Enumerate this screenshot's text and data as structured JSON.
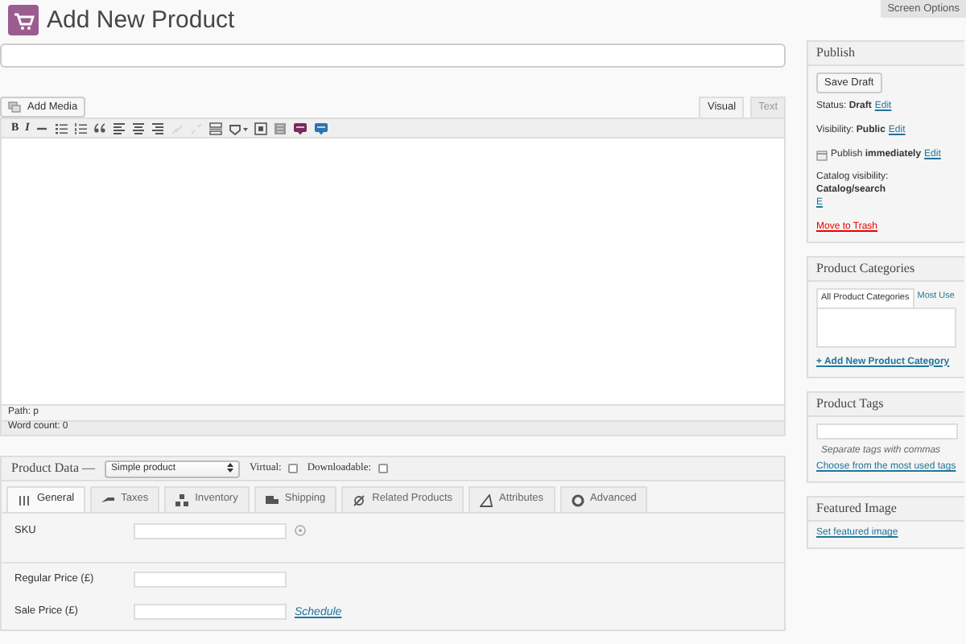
{
  "page_title": "Add New Product",
  "screen_options": "Screen Options",
  "editor": {
    "add_media": "Add Media",
    "tabs": [
      {
        "label": "Visual",
        "selected": true
      },
      {
        "label": "Text",
        "selected": false
      }
    ],
    "toolbar": [
      {
        "kind": "letter",
        "label": "B",
        "disabled": false
      },
      {
        "kind": "letter",
        "label": "I",
        "disabled": false
      },
      {
        "kind": "strike",
        "disabled": false
      },
      {
        "kind": "bullets",
        "disabled": false
      },
      {
        "kind": "numbers",
        "disabled": false
      },
      {
        "kind": "quote",
        "disabled": false
      },
      {
        "kind": "align-left",
        "disabled": false
      },
      {
        "kind": "align-center",
        "disabled": false
      },
      {
        "kind": "align-right",
        "disabled": false
      },
      {
        "kind": "link",
        "disabled": true
      },
      {
        "kind": "unlink",
        "disabled": true
      },
      {
        "kind": "more",
        "disabled": false
      },
      {
        "kind": "spellcheck",
        "disabled": false
      },
      {
        "kind": "fullscreen",
        "disabled": false
      },
      {
        "kind": "kitchen-sink",
        "disabled": false
      },
      {
        "kind": "plugin",
        "color": "#7b2a5c",
        "disabled": false
      },
      {
        "kind": "plugin",
        "color": "#2c73b0",
        "disabled": false
      }
    ],
    "path": "Path: p",
    "word_count": "Word count: 0"
  },
  "product_data": {
    "title": "Product Data —",
    "type": "Simple product",
    "options": [
      {
        "label": "Virtual:",
        "checked": false
      },
      {
        "label": "Downloadable:",
        "checked": false
      }
    ],
    "tabs": [
      {
        "label": "General",
        "kind": "general",
        "selected": true
      },
      {
        "label": "Taxes",
        "kind": "taxes",
        "selected": false
      },
      {
        "label": "Inventory",
        "kind": "inventory",
        "selected": false
      },
      {
        "label": "Shipping",
        "kind": "shipping",
        "selected": false
      },
      {
        "label": "Related Products",
        "kind": "related",
        "selected": false
      },
      {
        "label": "Attributes",
        "kind": "attributes",
        "selected": false
      },
      {
        "label": "Advanced",
        "kind": "advanced",
        "selected": false
      }
    ],
    "fields": [
      {
        "label": "SKU",
        "help": true
      },
      {
        "label": "Regular Price (£)",
        "help": false
      },
      {
        "label": "Sale Price (£)",
        "help": false,
        "link": "Schedule"
      }
    ]
  },
  "publish": {
    "title": "Publish",
    "save_draft": "Save Draft",
    "rows": [
      {
        "kind": "plain",
        "label": "Status:",
        "value": "Draft",
        "link": "Edit"
      },
      {
        "kind": "plain",
        "label": "Visibility:",
        "value": "Public",
        "link": "Edit"
      },
      {
        "kind": "calendar",
        "label": "Publish",
        "value": "immediately",
        "link": "Edit"
      },
      {
        "kind": "plain",
        "label": "Catalog visibility:",
        "value": "Catalog/search",
        "link": "E"
      }
    ],
    "trash": "Move to Trash"
  },
  "categories": {
    "title": "Product Categories",
    "tabs": [
      {
        "label": "All Product Categories",
        "selected": true
      },
      {
        "label": "Most Use",
        "selected": false
      }
    ],
    "add_link": "+ Add New Product Category"
  },
  "tags": {
    "title": "Product Tags",
    "hint": "Separate tags with commas",
    "link": "Choose from the most used tags"
  },
  "featured_image": {
    "title": "Featured Image",
    "link": "Set featured image"
  }
}
